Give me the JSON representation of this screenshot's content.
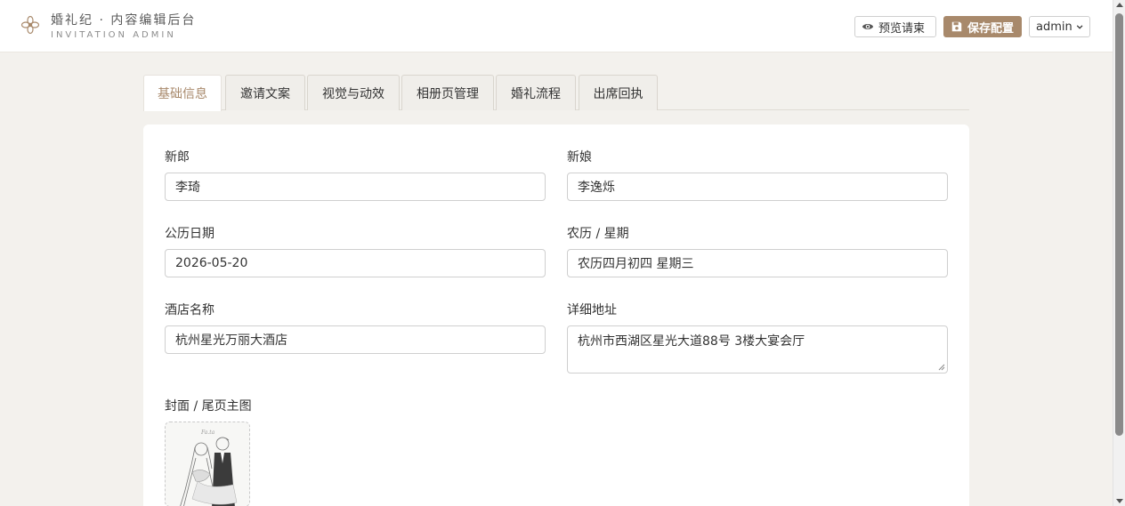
{
  "header": {
    "title": "婚礼纪 · 内容编辑后台",
    "subtitle": "INVITATION ADMIN",
    "logo_icon": "flower-logo-icon",
    "preview_label": "预览请柬",
    "save_label": "保存配置",
    "user_label": "admin",
    "accent_color": "#a8896b"
  },
  "tabs": [
    {
      "label": "基础信息",
      "active": true
    },
    {
      "label": "邀请文案",
      "active": false
    },
    {
      "label": "视觉与动效",
      "active": false
    },
    {
      "label": "相册页管理",
      "active": false
    },
    {
      "label": "婚礼流程",
      "active": false
    },
    {
      "label": "出席回执",
      "active": false
    }
  ],
  "form": {
    "groom": {
      "label": "新郎",
      "value": "李琦"
    },
    "bride": {
      "label": "新娘",
      "value": "李逸烁"
    },
    "solar_date": {
      "label": "公历日期",
      "value": "2026-05-20"
    },
    "lunar_date": {
      "label": "农历 / 星期",
      "value": "农历四月初四 星期三"
    },
    "hotel": {
      "label": "酒店名称",
      "value": "杭州星光万丽大酒店"
    },
    "address": {
      "label": "详细地址",
      "value": "杭州市西湖区星光大道88号 3楼大宴会厅"
    },
    "cover": {
      "label": "封面 / 尾页主图"
    }
  }
}
